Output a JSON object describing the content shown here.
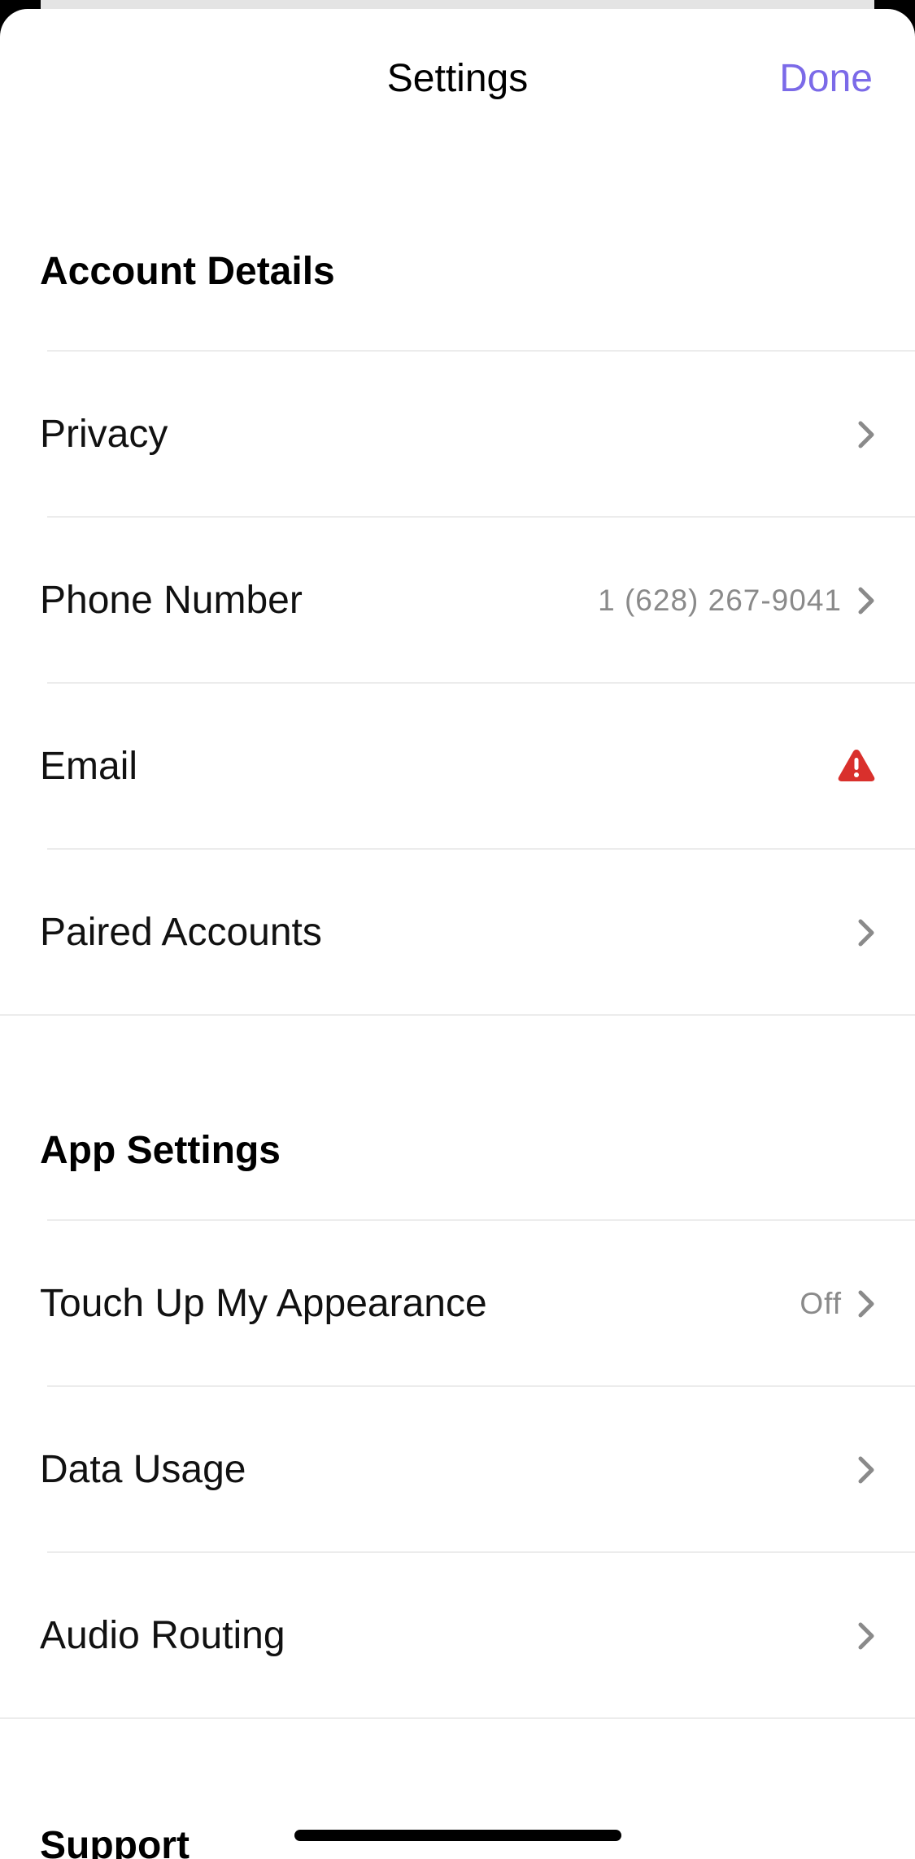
{
  "nav": {
    "title": "Settings",
    "done_label": "Done"
  },
  "sections": {
    "account": {
      "header": "Account Details",
      "privacy": {
        "label": "Privacy"
      },
      "phone": {
        "label": "Phone Number",
        "value": "1 (628) 267-9041"
      },
      "email": {
        "label": "Email",
        "status_icon": "warning-triangle-icon"
      },
      "paired": {
        "label": "Paired Accounts"
      }
    },
    "app": {
      "header": "App Settings",
      "touch_up": {
        "label": "Touch Up My Appearance",
        "value": "Off"
      },
      "data_usage": {
        "label": "Data Usage"
      },
      "audio_routing": {
        "label": "Audio Routing"
      }
    },
    "support": {
      "header": "Support"
    }
  },
  "colors": {
    "accent": "#7b6ae8",
    "warning": "#d9302c",
    "chevron": "#8a8a8a"
  }
}
